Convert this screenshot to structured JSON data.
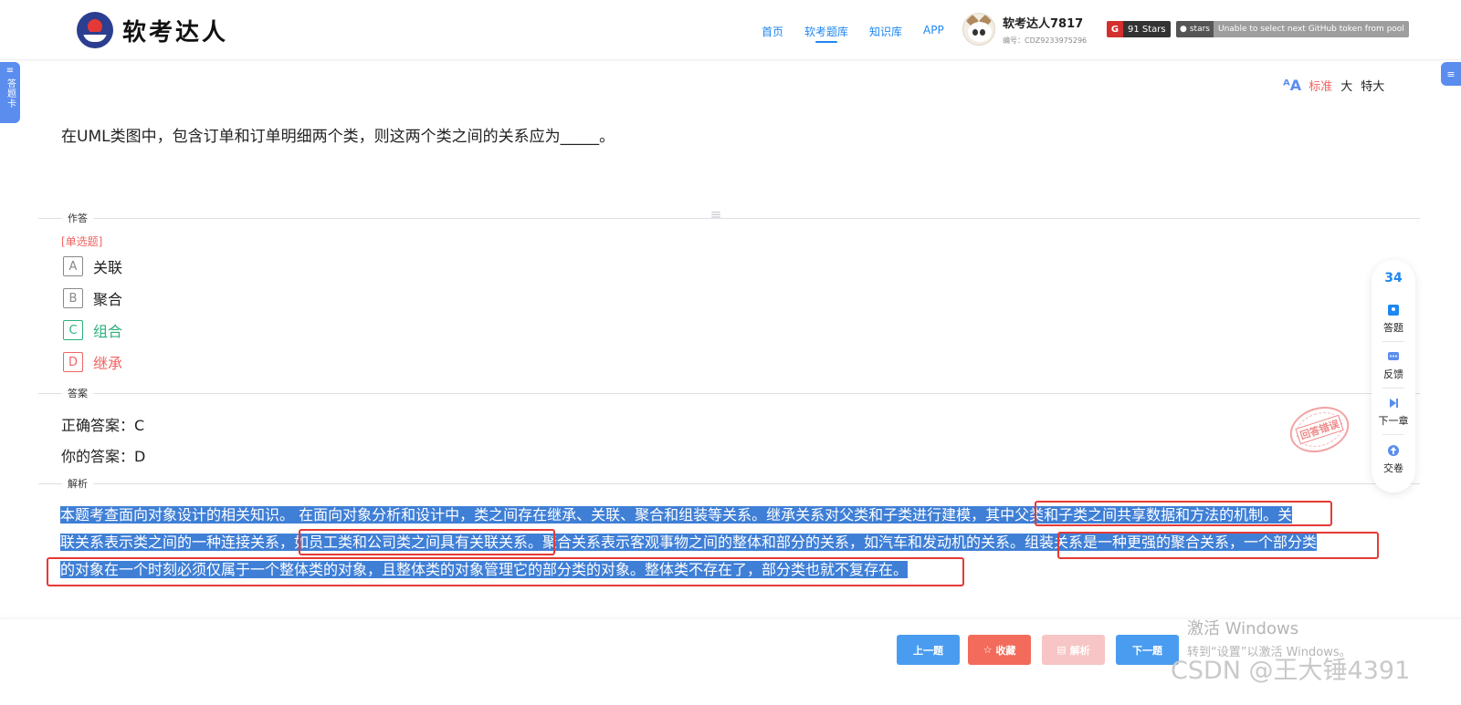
{
  "header": {
    "logo_text": "软考达人",
    "nav": [
      {
        "label": "首页",
        "active": false
      },
      {
        "label": "软考题库",
        "active": true
      },
      {
        "label": "知识库",
        "active": false
      },
      {
        "label": "APP",
        "active": false
      }
    ],
    "user": {
      "name": "软考达人7817",
      "id": "编号：CDZ9233975296"
    },
    "badge_stars": {
      "icon": "G",
      "label": "91 Stars"
    },
    "badge_github": {
      "label": "stars",
      "message": "Unable to select next GitHub token from pool"
    }
  },
  "side_tab_left": {
    "label": "答题卡"
  },
  "font_size": {
    "icon": "font-size-icon",
    "options": [
      "标准",
      "大",
      "特大"
    ],
    "selected": "标准"
  },
  "question": {
    "text": "在UML类图中，包含订单和订单明细两个类，则这两个类之间的关系应为_____。"
  },
  "sections": {
    "answer": "作答",
    "key": "答案",
    "analysis": "解析"
  },
  "question_type": "[单选题]",
  "options": [
    {
      "key": "A",
      "text": "关联",
      "state": "normal"
    },
    {
      "key": "B",
      "text": "聚合",
      "state": "normal"
    },
    {
      "key": "C",
      "text": "组合",
      "state": "correct"
    },
    {
      "key": "D",
      "text": "继承",
      "state": "wrong"
    }
  ],
  "correct_answer": "正确答案：C",
  "your_answer": "你的答案：D",
  "stamp": "回答错误",
  "analysis_lines": [
    "本题考查面向对象设计的相关知识。   在面向对象分析和设计中，类之间存在继承、关联、聚合和组装等关系。继承关系对父类和子类进行建模，其中父类和子类之间共享数据和方法的机制。关",
    "联关系表示类之间的一种连接关系，如员工类和公司类之间具有关联关系。聚合关系表示客观事物之间的整体和部分的关系，如汽车和发动机的关系。组装关系是一种更强的聚合关系，一个部分类",
    "的对象在一个时刻必须仅属于一个整体类的对象，且整体类的对象管理它的部分类的对象。整体类不存在了，部分类也就不复存在。"
  ],
  "rail": {
    "count": "34",
    "items": [
      {
        "label": "答题",
        "icon": "answer-icon"
      },
      {
        "label": "反馈",
        "icon": "feedback-icon"
      },
      {
        "label": "下一章",
        "icon": "next-chapter-icon"
      },
      {
        "label": "交卷",
        "icon": "submit-icon"
      }
    ]
  },
  "footer": {
    "prev": "上一题",
    "favorite": "收藏",
    "analysis": "解析",
    "next": "下一题"
  },
  "watermarks": {
    "windows_title": "激活 Windows",
    "windows_sub": "转到“设置”以激活 Windows。",
    "csdn": "CSDN @王大锤4391"
  },
  "colors": {
    "accent": "#1e87f0",
    "correct": "#2ab27b",
    "wrong": "#f06363",
    "selection": "#3f7fd6",
    "highlight_box": "#e53935"
  }
}
